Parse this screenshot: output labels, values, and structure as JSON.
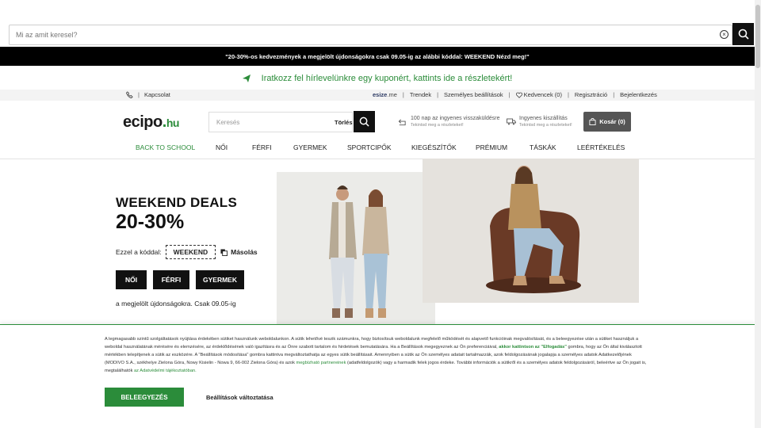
{
  "overlay_search": {
    "placeholder": "Mi az amit keresel?"
  },
  "promo_bar": {
    "text": "\"20-30%-os kedvezmények a megjelölt újdonságokra csak 09.05-ig az alábbi kóddal: WEEKEND Nézd meg!\""
  },
  "newsletter": {
    "text": "Iratkozz fel hírlevelünkre egy kuponért, kattints ide a részletekért!"
  },
  "utility": {
    "contact": "Kapcsolat",
    "esize": "esize",
    "esize_suffix": ".me",
    "trends": "Trendek",
    "personal_settings": "Személyes beállítások",
    "favorites": "Kedvencek (0)",
    "register": "Regisztráció",
    "login": "Bejelentkezés"
  },
  "header": {
    "logo_main": "ecipo",
    "logo_dot": ".",
    "logo_tld": "hu",
    "search_placeholder": "Keresés",
    "clear_label": "Törlés",
    "return_title": "100 nap az ingyenes visszaküldésre",
    "return_sub": "Tekintsd meg a részleteket!",
    "shipping_title": "Ingyenes kiszállítás",
    "shipping_sub": "Tekintsd meg a részleteket!",
    "cart_label": "Kosár (0)"
  },
  "nav": [
    "BACK TO SCHOOL",
    "NŐI",
    "FÉRFI",
    "GYERMEK",
    "SPORTCIPŐK",
    "KIEGÉSZÍTŐK",
    "PRÉMIUM",
    "TÁSKÁK",
    "LEÉRTÉKELÉS"
  ],
  "hero": {
    "title": "WEEKEND DEALS",
    "subtitle": "20-30%",
    "code_label": "Ezzel a kóddal:",
    "code": "WEEKEND",
    "copy_label": "Másolás",
    "buttons": [
      "NŐI",
      "FÉRFI",
      "GYERMEK"
    ],
    "note": "a megjelölt újdonságokra. Csak 09.05-ig"
  },
  "cookie": {
    "p1": "A legmagasabb szintű szolgáltatások nyújtása érdekében sütiket használunk weboldalunkon. A sütik lehetővé teszik számunkra, hogy biztosítsuk weboldalunk megfelelő működését és alapvető funkcióinak megvalósítását, és a beleegyezése után a sütiket használjuk a weboldal használatának mérésére és elemzésére, az érdeklődésének való igazításra és az Önre szabott tartalom és hirdetések bemutatására. Ha a Beállítások megegyeznek az Ön preferenciáival, ",
    "p1_link": "akkor kattintson az \"Elfogadás\"",
    "p2": " gombra, hogy az Ön által kiválasztott mértékben telepítjenek a sütik az eszközére. A \"Beállítások módosítása\" gombra kattintva megváltoztathatja az egyes sütik beállításait. Amennyiben a sütik az Ön személyes adatait tartalmazzák, azok feldolgozásának jogalapja a személyes adatok Adatkezelőjének (MODIVO S.A., székhelye Zielona Góra, Nowy Kisielin - Nowa 9, 66-002 Zielona Góra) és azok ",
    "p2_link": "megbízható partnereinek",
    "p3": " (adatfeldolgozók) vagy a harmadik felek jogos érdeke. További információk a sütikről és a személyes adatok feldolgozásáról, beleértve az Ön jogait is, megtalálhatók ",
    "p3_link": "az Adatvédelmi tájékoztatóban.",
    "accept_label": "BELEEGYEZÉS",
    "settings_label": "Beállítások változtatása"
  },
  "colors": {
    "brand_green": "#2b8c3a",
    "black": "#111111"
  }
}
